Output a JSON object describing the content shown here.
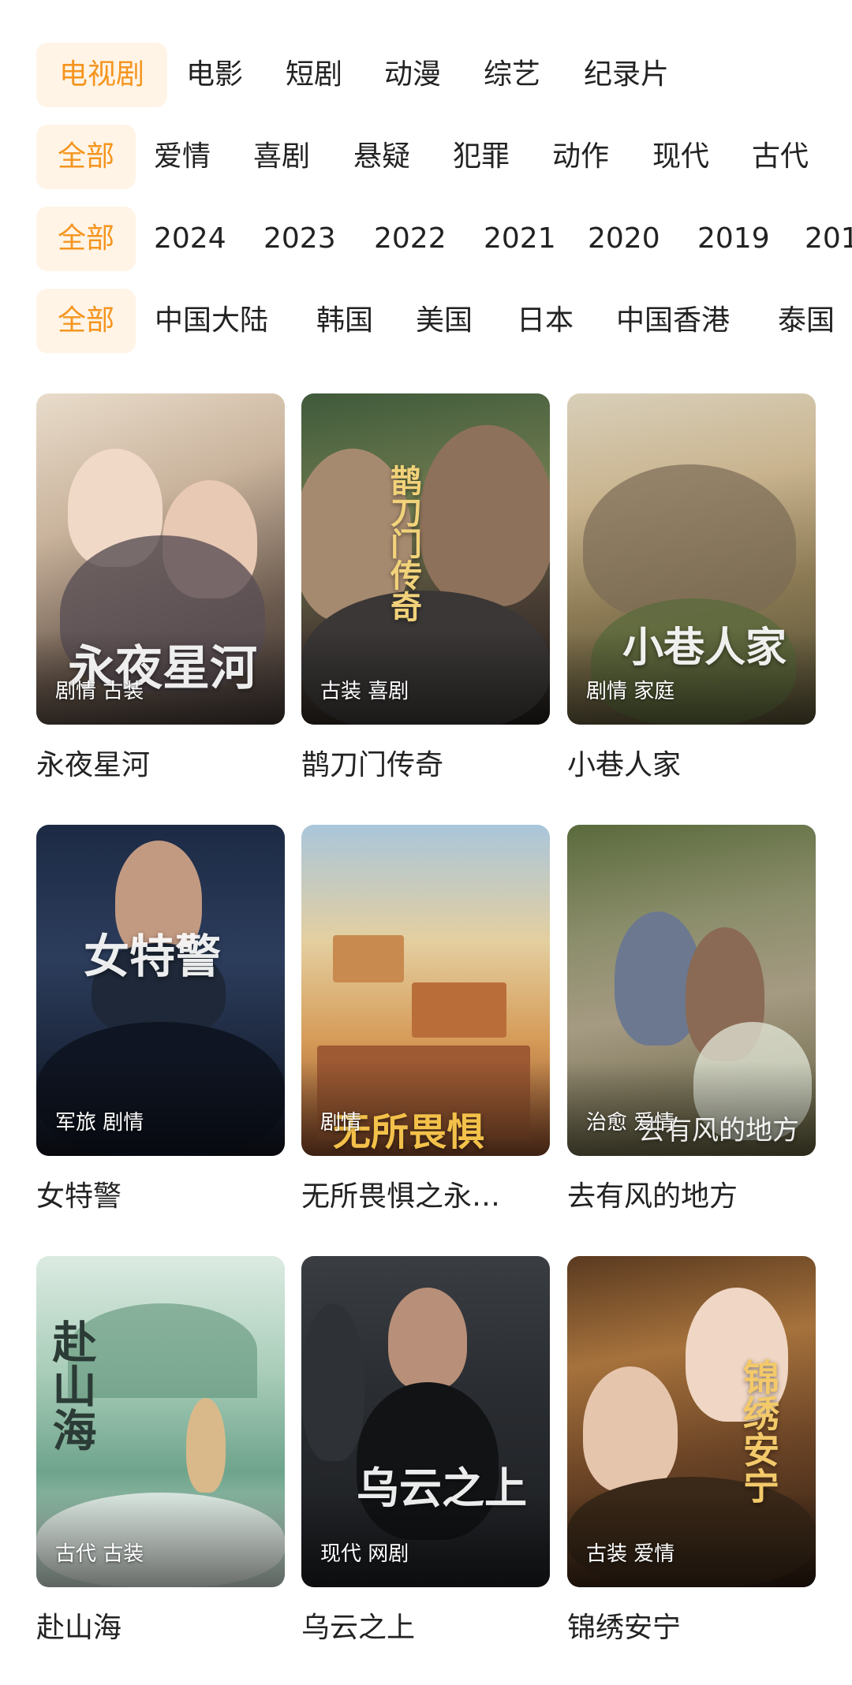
{
  "filters": {
    "category": [
      "电视剧",
      "电影",
      "短剧",
      "动漫",
      "综艺",
      "纪录片"
    ],
    "genre": [
      "全部",
      "爱情",
      "喜剧",
      "悬疑",
      "犯罪",
      "动作",
      "现代",
      "古代"
    ],
    "year": [
      "全部",
      "2024",
      "2023",
      "2022",
      "2021",
      "2020",
      "2019",
      "201"
    ],
    "region": [
      "全部",
      "中国大陆",
      "韩国",
      "美国",
      "日本",
      "中国香港",
      "泰国"
    ]
  },
  "cards": [
    {
      "title": "永夜星河",
      "tags": "剧情 古装",
      "art": "永夜星河"
    },
    {
      "title": "鹊刀门传奇",
      "tags": "古装 喜剧",
      "art": "鹊刀门传奇"
    },
    {
      "title": "小巷人家",
      "tags": "剧情 家庭",
      "art": "小巷人家"
    },
    {
      "title": "女特警",
      "tags": "军旅 剧情",
      "art": "女特警"
    },
    {
      "title": "无所畏惧之永…",
      "tags": "剧情",
      "art": "无所畏惧"
    },
    {
      "title": "去有风的地方",
      "tags": "治愈 爱情",
      "art": "去有风的地方"
    },
    {
      "title": "赴山海",
      "tags": "古代 古装",
      "art": "赴山海"
    },
    {
      "title": "乌云之上",
      "tags": "现代 网剧",
      "art": "乌云之上"
    },
    {
      "title": "锦绣安宁",
      "tags": "古装 爱情",
      "art": "锦绣安宁"
    }
  ],
  "colors": {
    "accent": "#f5951f",
    "accent_bg": "#fff4e6",
    "text": "#222222"
  }
}
